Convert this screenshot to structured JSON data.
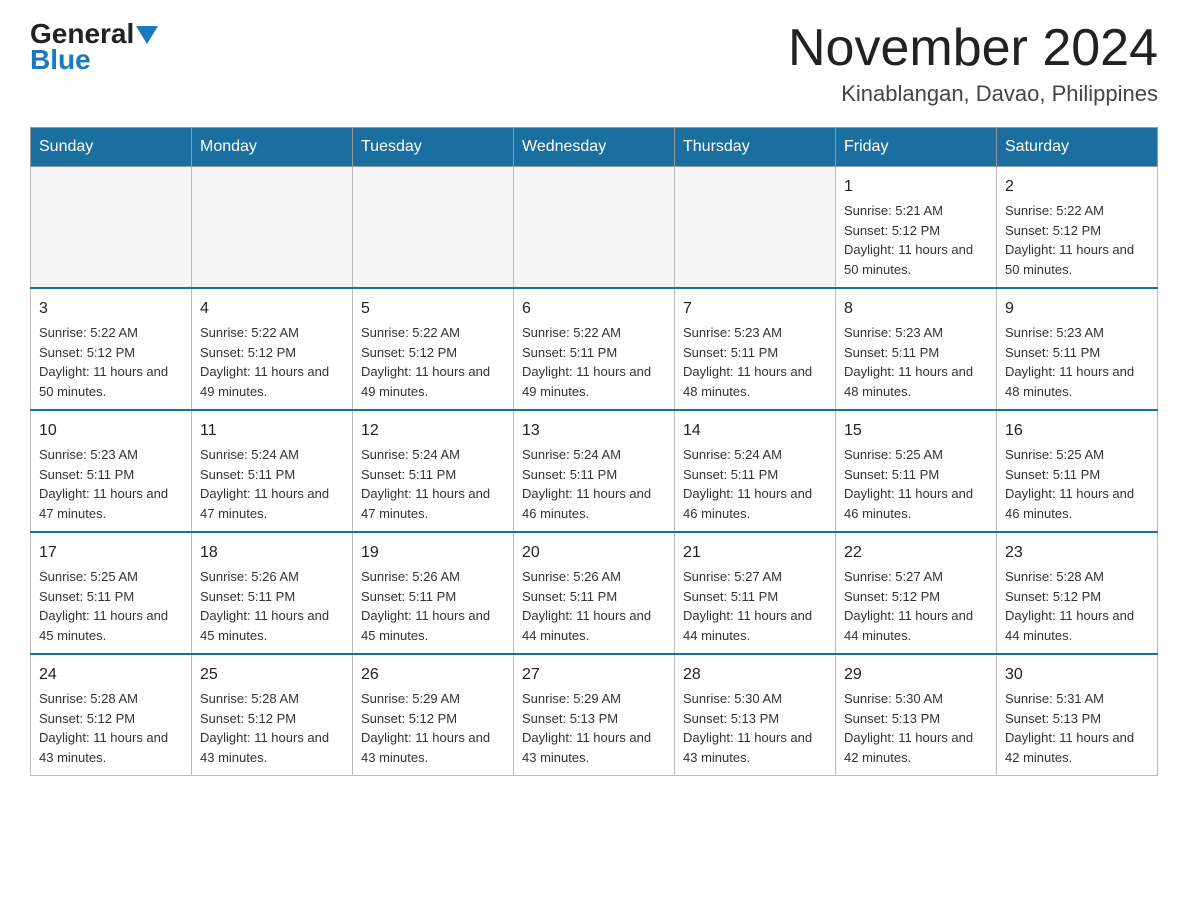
{
  "header": {
    "logo_general": "General",
    "logo_blue": "Blue",
    "month_year": "November 2024",
    "location": "Kinablangan, Davao, Philippines"
  },
  "days_of_week": [
    "Sunday",
    "Monday",
    "Tuesday",
    "Wednesday",
    "Thursday",
    "Friday",
    "Saturday"
  ],
  "weeks": [
    [
      {
        "day": "",
        "info": ""
      },
      {
        "day": "",
        "info": ""
      },
      {
        "day": "",
        "info": ""
      },
      {
        "day": "",
        "info": ""
      },
      {
        "day": "",
        "info": ""
      },
      {
        "day": "1",
        "info": "Sunrise: 5:21 AM\nSunset: 5:12 PM\nDaylight: 11 hours and 50 minutes."
      },
      {
        "day": "2",
        "info": "Sunrise: 5:22 AM\nSunset: 5:12 PM\nDaylight: 11 hours and 50 minutes."
      }
    ],
    [
      {
        "day": "3",
        "info": "Sunrise: 5:22 AM\nSunset: 5:12 PM\nDaylight: 11 hours and 50 minutes."
      },
      {
        "day": "4",
        "info": "Sunrise: 5:22 AM\nSunset: 5:12 PM\nDaylight: 11 hours and 49 minutes."
      },
      {
        "day": "5",
        "info": "Sunrise: 5:22 AM\nSunset: 5:12 PM\nDaylight: 11 hours and 49 minutes."
      },
      {
        "day": "6",
        "info": "Sunrise: 5:22 AM\nSunset: 5:11 PM\nDaylight: 11 hours and 49 minutes."
      },
      {
        "day": "7",
        "info": "Sunrise: 5:23 AM\nSunset: 5:11 PM\nDaylight: 11 hours and 48 minutes."
      },
      {
        "day": "8",
        "info": "Sunrise: 5:23 AM\nSunset: 5:11 PM\nDaylight: 11 hours and 48 minutes."
      },
      {
        "day": "9",
        "info": "Sunrise: 5:23 AM\nSunset: 5:11 PM\nDaylight: 11 hours and 48 minutes."
      }
    ],
    [
      {
        "day": "10",
        "info": "Sunrise: 5:23 AM\nSunset: 5:11 PM\nDaylight: 11 hours and 47 minutes."
      },
      {
        "day": "11",
        "info": "Sunrise: 5:24 AM\nSunset: 5:11 PM\nDaylight: 11 hours and 47 minutes."
      },
      {
        "day": "12",
        "info": "Sunrise: 5:24 AM\nSunset: 5:11 PM\nDaylight: 11 hours and 47 minutes."
      },
      {
        "day": "13",
        "info": "Sunrise: 5:24 AM\nSunset: 5:11 PM\nDaylight: 11 hours and 46 minutes."
      },
      {
        "day": "14",
        "info": "Sunrise: 5:24 AM\nSunset: 5:11 PM\nDaylight: 11 hours and 46 minutes."
      },
      {
        "day": "15",
        "info": "Sunrise: 5:25 AM\nSunset: 5:11 PM\nDaylight: 11 hours and 46 minutes."
      },
      {
        "day": "16",
        "info": "Sunrise: 5:25 AM\nSunset: 5:11 PM\nDaylight: 11 hours and 46 minutes."
      }
    ],
    [
      {
        "day": "17",
        "info": "Sunrise: 5:25 AM\nSunset: 5:11 PM\nDaylight: 11 hours and 45 minutes."
      },
      {
        "day": "18",
        "info": "Sunrise: 5:26 AM\nSunset: 5:11 PM\nDaylight: 11 hours and 45 minutes."
      },
      {
        "day": "19",
        "info": "Sunrise: 5:26 AM\nSunset: 5:11 PM\nDaylight: 11 hours and 45 minutes."
      },
      {
        "day": "20",
        "info": "Sunrise: 5:26 AM\nSunset: 5:11 PM\nDaylight: 11 hours and 44 minutes."
      },
      {
        "day": "21",
        "info": "Sunrise: 5:27 AM\nSunset: 5:11 PM\nDaylight: 11 hours and 44 minutes."
      },
      {
        "day": "22",
        "info": "Sunrise: 5:27 AM\nSunset: 5:12 PM\nDaylight: 11 hours and 44 minutes."
      },
      {
        "day": "23",
        "info": "Sunrise: 5:28 AM\nSunset: 5:12 PM\nDaylight: 11 hours and 44 minutes."
      }
    ],
    [
      {
        "day": "24",
        "info": "Sunrise: 5:28 AM\nSunset: 5:12 PM\nDaylight: 11 hours and 43 minutes."
      },
      {
        "day": "25",
        "info": "Sunrise: 5:28 AM\nSunset: 5:12 PM\nDaylight: 11 hours and 43 minutes."
      },
      {
        "day": "26",
        "info": "Sunrise: 5:29 AM\nSunset: 5:12 PM\nDaylight: 11 hours and 43 minutes."
      },
      {
        "day": "27",
        "info": "Sunrise: 5:29 AM\nSunset: 5:13 PM\nDaylight: 11 hours and 43 minutes."
      },
      {
        "day": "28",
        "info": "Sunrise: 5:30 AM\nSunset: 5:13 PM\nDaylight: 11 hours and 43 minutes."
      },
      {
        "day": "29",
        "info": "Sunrise: 5:30 AM\nSunset: 5:13 PM\nDaylight: 11 hours and 42 minutes."
      },
      {
        "day": "30",
        "info": "Sunrise: 5:31 AM\nSunset: 5:13 PM\nDaylight: 11 hours and 42 minutes."
      }
    ]
  ]
}
